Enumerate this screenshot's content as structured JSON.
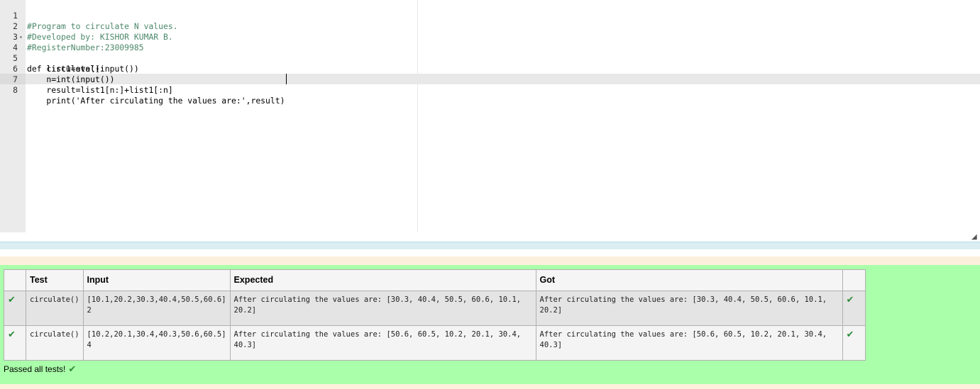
{
  "editor": {
    "lines": [
      {
        "n": "1",
        "text": "#Program to circulate N values."
      },
      {
        "n": "2",
        "text": "#Developed by: KISHOR KUMAR B."
      },
      {
        "n": "3",
        "text": "#RegisterNumber:23009985"
      },
      {
        "n": "4",
        "text": "def circulate():"
      },
      {
        "n": "5",
        "text": "    list1=eval(input())"
      },
      {
        "n": "6",
        "text": "    n=int(input())"
      },
      {
        "n": "7",
        "text": "    result=list1[n:]+list1[:n]"
      },
      {
        "n": "8",
        "text": "    print('After circulating the values are:',result)"
      }
    ]
  },
  "results": {
    "headers": {
      "test": "Test",
      "input": "Input",
      "expected": "Expected",
      "got": "Got"
    },
    "rows": [
      {
        "test": "circulate()",
        "input_line1": "[10.1,20.2,30.3,40.4,50.5,60.6]",
        "input_line2": "2",
        "expected": "After circulating the values are: [30.3, 40.4, 50.5, 60.6, 10.1, 20.2]",
        "got": "After circulating the values are: [30.3, 40.4, 50.5, 60.6, 10.1, 20.2]",
        "status": "pass"
      },
      {
        "test": "circulate()",
        "input_line1": "[10.2,20.1,30.4,40.3,50.6,60.5]",
        "input_line2": "4",
        "expected": "After circulating the values are: [50.6, 60.5, 10.2, 20.1, 30.4, 40.3]",
        "got": "After circulating the values are: [50.6, 60.5, 10.2, 20.1, 30.4, 40.3]",
        "status": "pass"
      }
    ],
    "summary": "Passed all tests!"
  },
  "colors": {
    "results_bg": "#aaffaa",
    "check": "#2e8b3a"
  },
  "icons": {
    "pass": "check-icon",
    "resize": "resize-grip-icon"
  }
}
